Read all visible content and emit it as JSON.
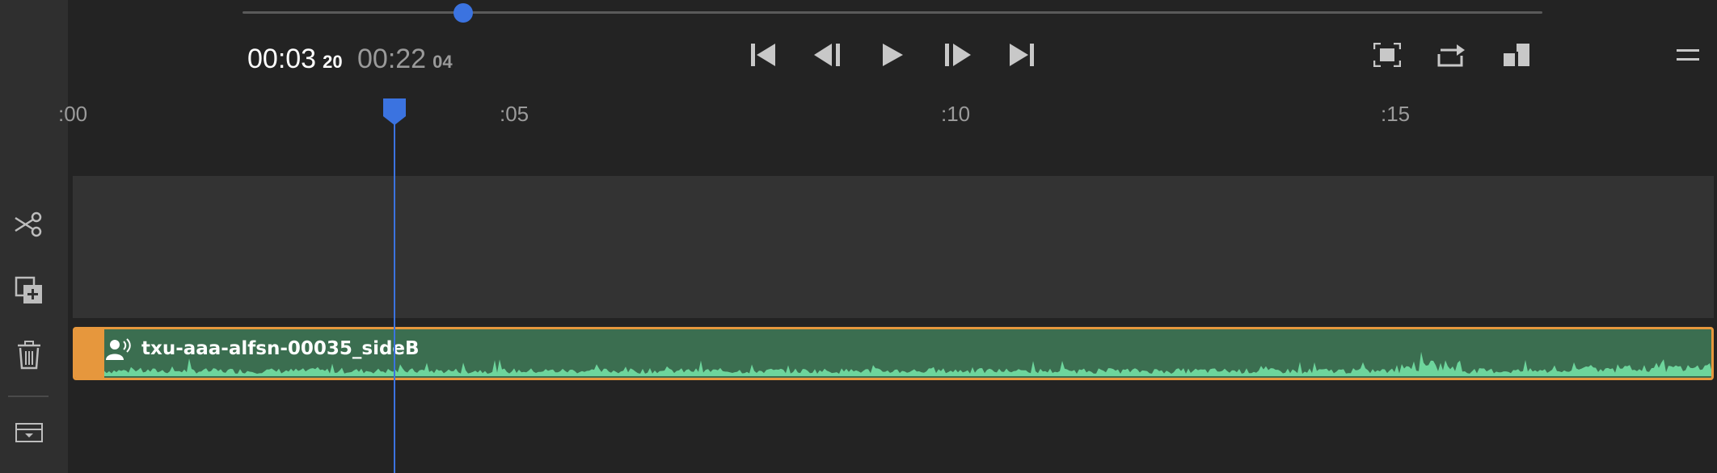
{
  "timecode": {
    "current": "00:03",
    "current_frames": "20",
    "duration": "00:22",
    "duration_frames": "04"
  },
  "scrubber": {
    "progress": 0.172
  },
  "ruler": {
    "labels": [
      ":00",
      ":05",
      ":10",
      ":15"
    ]
  },
  "clip": {
    "name": "txu-aaa-alfsn-00035_sideB"
  },
  "colors": {
    "background": "#232323",
    "rail": "#2f2f2f",
    "accent": "#3b73e0",
    "clip_fill": "#3b6e50",
    "clip_border": "#e6973d",
    "waveform": "#6dd59c"
  },
  "icons": {
    "rail": [
      "scissors-icon",
      "duplicate-add-icon",
      "trash-icon",
      "track-options-icon"
    ],
    "transport": [
      "skip-to-start-icon",
      "step-back-icon",
      "play-icon",
      "step-forward-icon",
      "skip-to-end-icon"
    ],
    "view": [
      "fit-frame-icon",
      "loop-icon",
      "aspect-ratio-icon",
      "menu-icon"
    ]
  }
}
